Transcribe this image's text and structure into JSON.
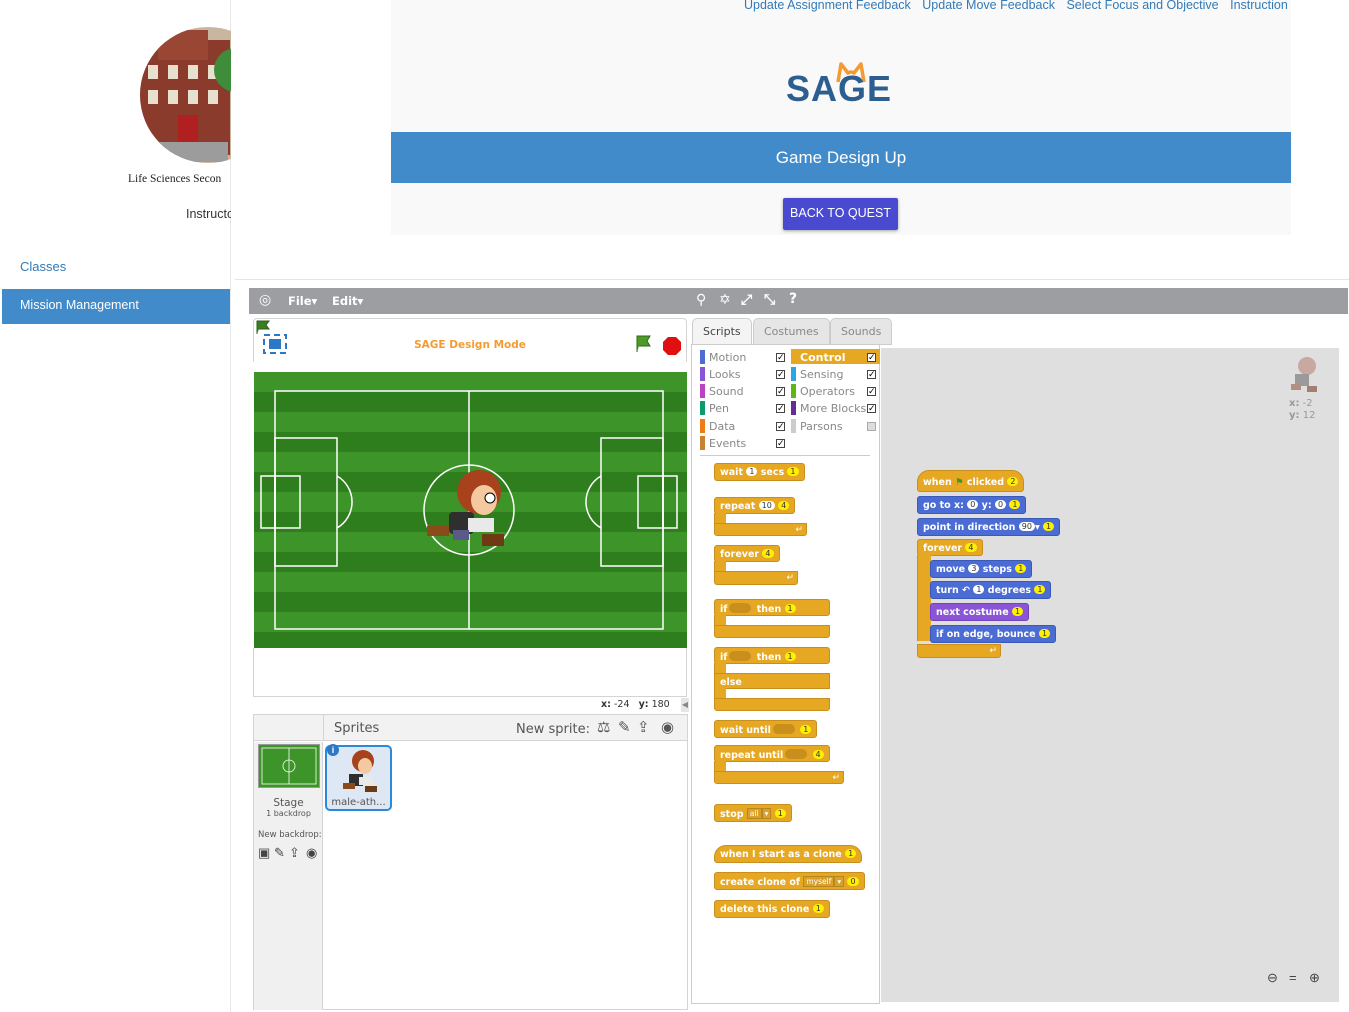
{
  "sidebar": {
    "logo_caption": "Life Sciences Secon",
    "instructor_label": "Instructo",
    "nav": [
      {
        "label": "Classes",
        "active": false
      },
      {
        "label": "Mission Management",
        "active": true
      }
    ]
  },
  "header": {
    "links": [
      "Update Assignment Feedback",
      "Update Move Feedback",
      "Select Focus and Objective",
      "Instruction"
    ],
    "brand": "SAGE",
    "banner_title": "Game Design Up",
    "back_button": "BACK TO QUEST"
  },
  "scratch": {
    "menu": {
      "file": "File",
      "edit": "Edit"
    },
    "stage_title": "SAGE Design Mode",
    "mouse": {
      "x_label": "x:",
      "x_value": "-24",
      "y_label": "y:",
      "y_value": "180"
    },
    "sprites": {
      "header": "Sprites",
      "new_sprite_label": "New sprite:",
      "stage_label": "Stage",
      "stage_backdrops": "1 backdrop",
      "new_backdrop_label": "New backdrop:",
      "items": [
        {
          "name": "male-ath..."
        }
      ]
    },
    "tabs": [
      "Scripts",
      "Costumes",
      "Sounds"
    ],
    "active_tab": "Scripts",
    "categories_left": [
      "Motion",
      "Looks",
      "Sound",
      "Pen",
      "Data",
      "Events"
    ],
    "categories_right": [
      "Control",
      "Sensing",
      "Operators",
      "More Blocks",
      "Parsons"
    ],
    "active_category": "Control",
    "category_colors": {
      "Motion": "#4a6cd4",
      "Looks": "#8a55d7",
      "Sound": "#bb42c3",
      "Pen": "#0e9a6c",
      "Data": "#ee7d16",
      "Events": "#c88330",
      "Control": "#e6a822",
      "Sensing": "#2ca5e2",
      "Operators": "#5cb712",
      "More Blocks": "#632d99",
      "Parsons": "#cccccc"
    },
    "palette_blocks": {
      "wait": {
        "pre": "wait",
        "arg": "1",
        "post": "secs",
        "cost": "1"
      },
      "repeat": {
        "label": "repeat",
        "arg": "10",
        "cost": "4"
      },
      "forever": {
        "label": "forever",
        "cost": "4"
      },
      "if1": {
        "label": "if",
        "then": "then",
        "cost": "1"
      },
      "if2": {
        "label": "if",
        "then": "then",
        "else": "else",
        "cost": "1"
      },
      "wait_until": {
        "label": "wait until",
        "cost": "1"
      },
      "repeat_until": {
        "label": "repeat until",
        "cost": "4"
      },
      "stop": {
        "label": "stop",
        "option": "all",
        "cost": "1"
      },
      "clone_start": {
        "label": "when I start as a clone",
        "cost": "1"
      },
      "create_clone": {
        "label": "create clone of",
        "option": "myself",
        "cost": "0"
      },
      "delete_clone": {
        "label": "delete this clone",
        "cost": "1"
      }
    },
    "sprite_info": {
      "x_label": "x:",
      "x": "-2",
      "y_label": "y:",
      "y": "12"
    },
    "script": {
      "hat": {
        "when": "when",
        "clicked": "clicked",
        "cost": "2"
      },
      "goto": {
        "label": "go to x:",
        "x": "0",
        "y_label": "y:",
        "y": "0",
        "cost": "1"
      },
      "point": {
        "label": "point in direction",
        "value": "90",
        "cost": "1"
      },
      "forever": {
        "label": "forever",
        "cost": "4"
      },
      "move": {
        "label": "move",
        "value": "3",
        "post": "steps",
        "cost": "1"
      },
      "turn": {
        "label": "turn",
        "value": "1",
        "post": "degrees",
        "cost": "1"
      },
      "next_costume": {
        "label": "next costume",
        "cost": "1"
      },
      "bounce": {
        "label": "if on edge, bounce",
        "cost": "1"
      }
    }
  }
}
